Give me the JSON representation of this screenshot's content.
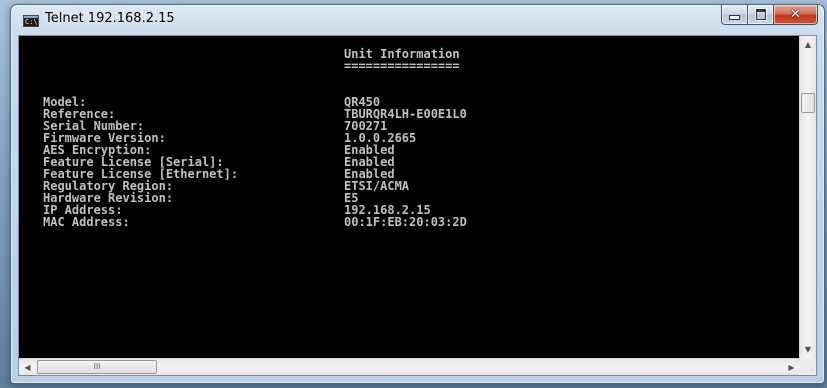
{
  "window": {
    "title": "Telnet 192.168.2.15",
    "icon_text": "C:\\",
    "controls": {
      "minimize": "minimize",
      "maximize": "maximize",
      "close": "✕"
    }
  },
  "console": {
    "heading": "Unit Information",
    "heading_rule": "================",
    "rows": [
      {
        "label": "Model:",
        "value": "QR450"
      },
      {
        "label": "Reference:",
        "value": "TBURQR4LH-E00E1L0"
      },
      {
        "label": "Serial Number:",
        "value": "700271"
      },
      {
        "label": "Firmware Version:",
        "value": "1.0.0.2665"
      },
      {
        "label": "AES Encryption:",
        "value": "Enabled"
      },
      {
        "label": "Feature License [Serial]:",
        "value": "Enabled"
      },
      {
        "label": "Feature License [Ethernet]:",
        "value": "Enabled"
      },
      {
        "label": "Regulatory Region:",
        "value": "ETSI/ACMA"
      },
      {
        "label": "Hardware Revision:",
        "value": "E5"
      },
      {
        "label": "IP Address:",
        "value": "192.168.2.15"
      },
      {
        "label": "MAC Address:",
        "value": "00:1F:EB:20:03:2D"
      }
    ]
  },
  "scrollbars": {
    "up_arrow": "▲",
    "down_arrow": "▼",
    "left_arrow": "◀",
    "right_arrow": "▶",
    "h_thumb_grip": "III"
  },
  "colors": {
    "console_background": "#000000",
    "console_text": "#c0c0c0",
    "close_button": "#c0391f"
  },
  "icons": {
    "app": "console-icon",
    "minimize": "minimize-icon",
    "maximize": "maximize-icon",
    "close": "close-icon"
  }
}
